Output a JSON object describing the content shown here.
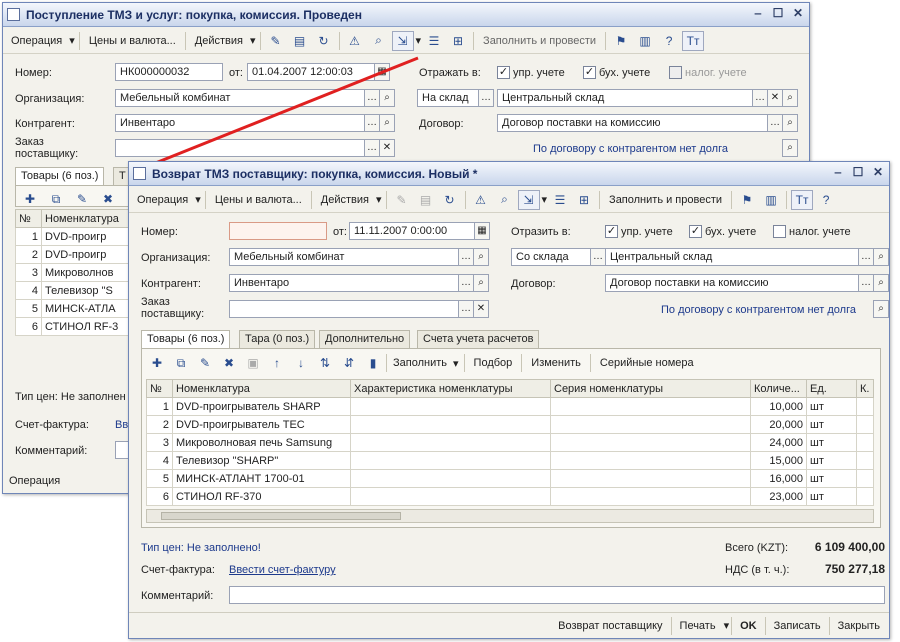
{
  "w1": {
    "title": "Поступление ТМЗ и услуг: покупка, комиссия. Проведен",
    "menu": [
      "Операция",
      "Цены и валюта...",
      "Действия"
    ],
    "fill_btn": "Заполнить и провести",
    "number_label": "Номер:",
    "number": "НК000000032",
    "date_label": "от:",
    "date": "01.04.2007 12:00:03",
    "reflect_label": "Отражать в:",
    "chk_upr": "упр. учете",
    "chk_buh": "бух. учете",
    "chk_nal": "налог. учете",
    "org_label": "Организация:",
    "org": "Мебельный комбинат",
    "wh_type": "На склад",
    "wh": "Центральный склад",
    "contr_label": "Контрагент:",
    "contr": "Инвентаро",
    "dog_label": "Договор:",
    "dog": "Договор поставки на комиссию",
    "order_label": "Заказ поставщику:",
    "debt": "По договору с контрагентом нет долга",
    "tab_goods": "Товары (6 поз.)",
    "tab_2": "Т",
    "col_n": "№",
    "col_name": "Номенклатура",
    "rows": [
      "DVD-проигр",
      "DVD-проигр",
      "Микроволнов",
      "Телевизор \"S",
      "МИНСК-АТЛА",
      "СТИНОЛ RF-3"
    ],
    "price_label": "Тип цен: Не заполнен",
    "invoice_label": "Счет-фактура:",
    "invoice": "Вв",
    "comment_label": "Комментарий:",
    "status_item": "Операция"
  },
  "w2": {
    "title": "Возврат ТМЗ поставщику: покупка, комиссия. Новый *",
    "menu": [
      "Операция",
      "Цены и валюта...",
      "Действия"
    ],
    "fill_btn": "Заполнить и провести",
    "number_label": "Номер:",
    "number": "",
    "date_label": "от:",
    "date": "11.11.2007 0:00:00",
    "reflect_label": "Отразить в:",
    "chk_upr": "упр. учете",
    "chk_buh": "бух. учете",
    "chk_nal": "налог. учете",
    "org_label": "Организация:",
    "org": "Мебельный комбинат",
    "wh_type": "Со склада",
    "wh": "Центральный склад",
    "contr_label": "Контрагент:",
    "contr": "Инвентаро",
    "dog_label": "Договор:",
    "dog": "Договор поставки на комиссию",
    "order_label": "Заказ поставщику:",
    "debt": "По договору с контрагентом нет долга",
    "tabs": [
      "Товары (6 поз.)",
      "Тара (0 поз.)",
      "Дополнительно",
      "Счета учета расчетов"
    ],
    "grid_fill": "Заполнить",
    "grid_select": "Подбор",
    "grid_change": "Изменить",
    "grid_serial": "Серийные номера",
    "cols": [
      "№",
      "Номенклатура",
      "Характеристика номенклатуры",
      "Серия номенклатуры",
      "Количе...",
      "Ед.",
      "К."
    ],
    "rows": [
      {
        "n": "1",
        "name": "DVD-проигрыватель SHARP",
        "qty": "10,000",
        "unit": "шт"
      },
      {
        "n": "2",
        "name": "DVD-проигрыватель TEC",
        "qty": "20,000",
        "unit": "шт"
      },
      {
        "n": "3",
        "name": "Микроволновая печь Samsung",
        "qty": "24,000",
        "unit": "шт"
      },
      {
        "n": "4",
        "name": "Телевизор \"SHARP\"",
        "qty": "15,000",
        "unit": "шт"
      },
      {
        "n": "5",
        "name": "МИНСК-АТЛАНТ 1700-01",
        "qty": "16,000",
        "unit": "шт"
      },
      {
        "n": "6",
        "name": "СТИНОЛ RF-370",
        "qty": "23,000",
        "unit": "шт"
      }
    ],
    "price_label": "Тип цен: Не заполнено!",
    "total_label": "Всего (KZT):",
    "total": "6 109 400,00",
    "vat_label": "НДС (в т. ч.):",
    "vat": "750 277,18",
    "invoice_label": "Счет-фактура:",
    "invoice": "Ввести счет-фактуру",
    "comment_label": "Комментарий:",
    "footer": [
      "Возврат поставщику",
      "Печать",
      "OK",
      "Записать",
      "Закрыть"
    ]
  }
}
